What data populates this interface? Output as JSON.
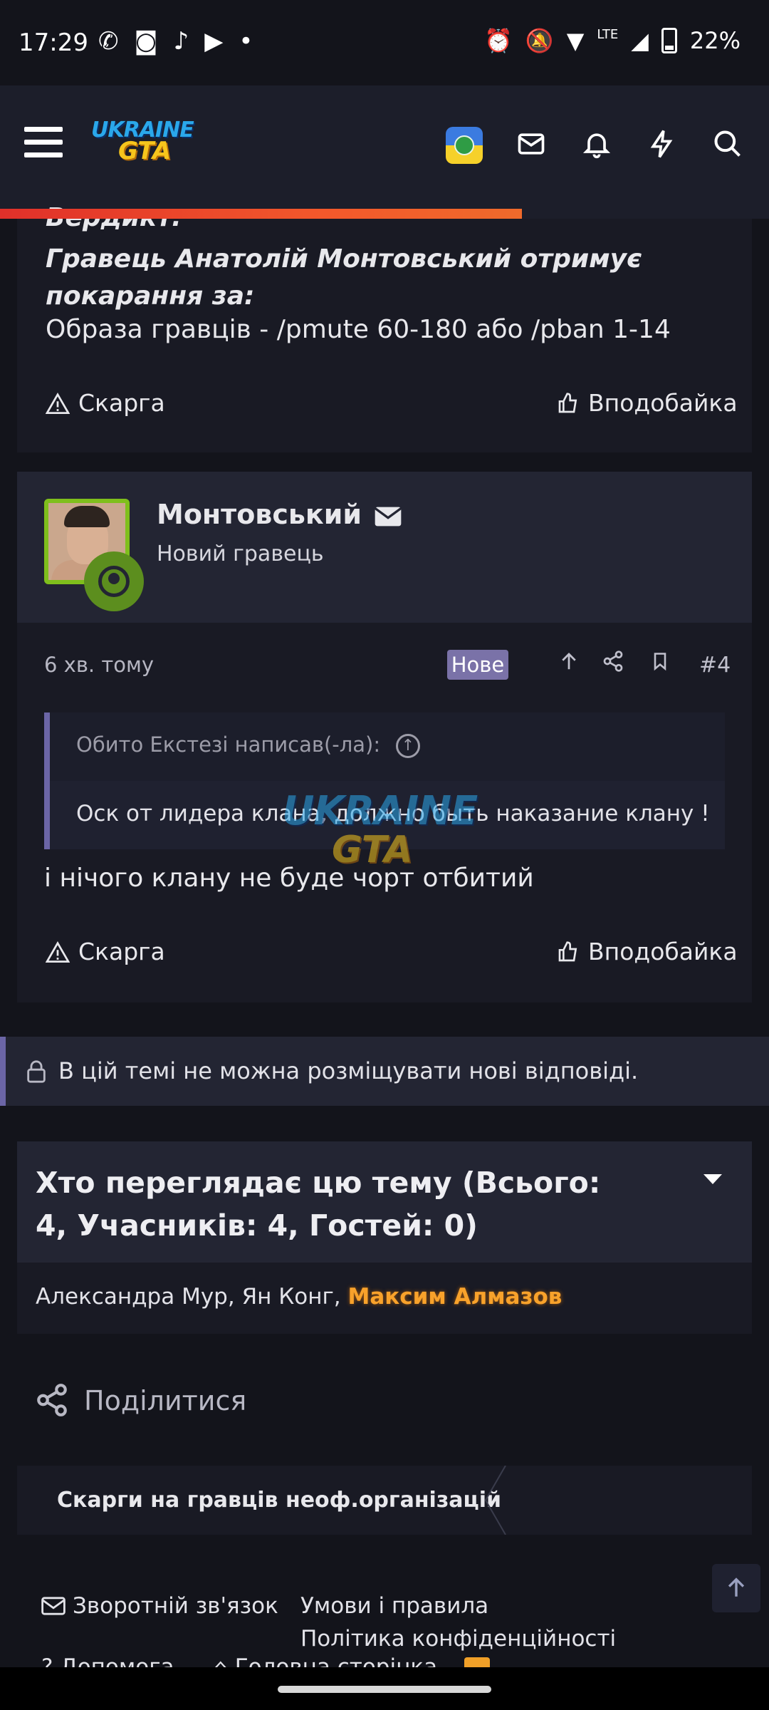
{
  "status_bar": {
    "time": "17:29",
    "battery": "22%",
    "network": "LTE"
  },
  "header": {
    "logo_top": "UKRAINE",
    "logo_bottom": "GTA"
  },
  "post1": {
    "verdict_label": "Вердикт:",
    "verdict_bold": "Гравець Анатолій Монтовський отримує покарання за:",
    "verdict_text": "Образа гравців - /pmute 60-180 або /pban 1-14",
    "report_label": "Скарга",
    "like_label": "Вподобайка"
  },
  "post2": {
    "username": "Монтовський",
    "user_title": "Новий гравець",
    "time": "6 хв. тому",
    "badge": "Нове",
    "post_number": "#4",
    "quote_author": "Обито Екстезі написав(-ла):",
    "quote_text": "Оск от лидера клана, должно быть наказание клану !",
    "reply_text": "і нічого клану не буде чорт отбитий",
    "report_label": "Скарга",
    "like_label": "Вподобайка"
  },
  "locked_notice": "В цій темі не можна розміщувати нові відповіді.",
  "viewers": {
    "title": "Хто переглядає цю тему (Всього: 4, Учасників: 4, Гостей: 0)",
    "names_plain": "Александра Мур, Ян Конг,",
    "name_highlight": "Максим Алмазов"
  },
  "share_label": "Поділитися",
  "breadcrumb": "Скарги на гравців неоф.організацій",
  "footer": {
    "contact": "Зворотній зв'язок",
    "terms": "Умови і правила",
    "privacy": "Політика конфіденційності",
    "help": "Допомога",
    "home": "Головна сторінка"
  },
  "colors": {
    "accent": "#6b65a6",
    "highlight_user": "#f8a22b",
    "progress": "#f2572b",
    "avatar_border": "#7fbf1c"
  }
}
